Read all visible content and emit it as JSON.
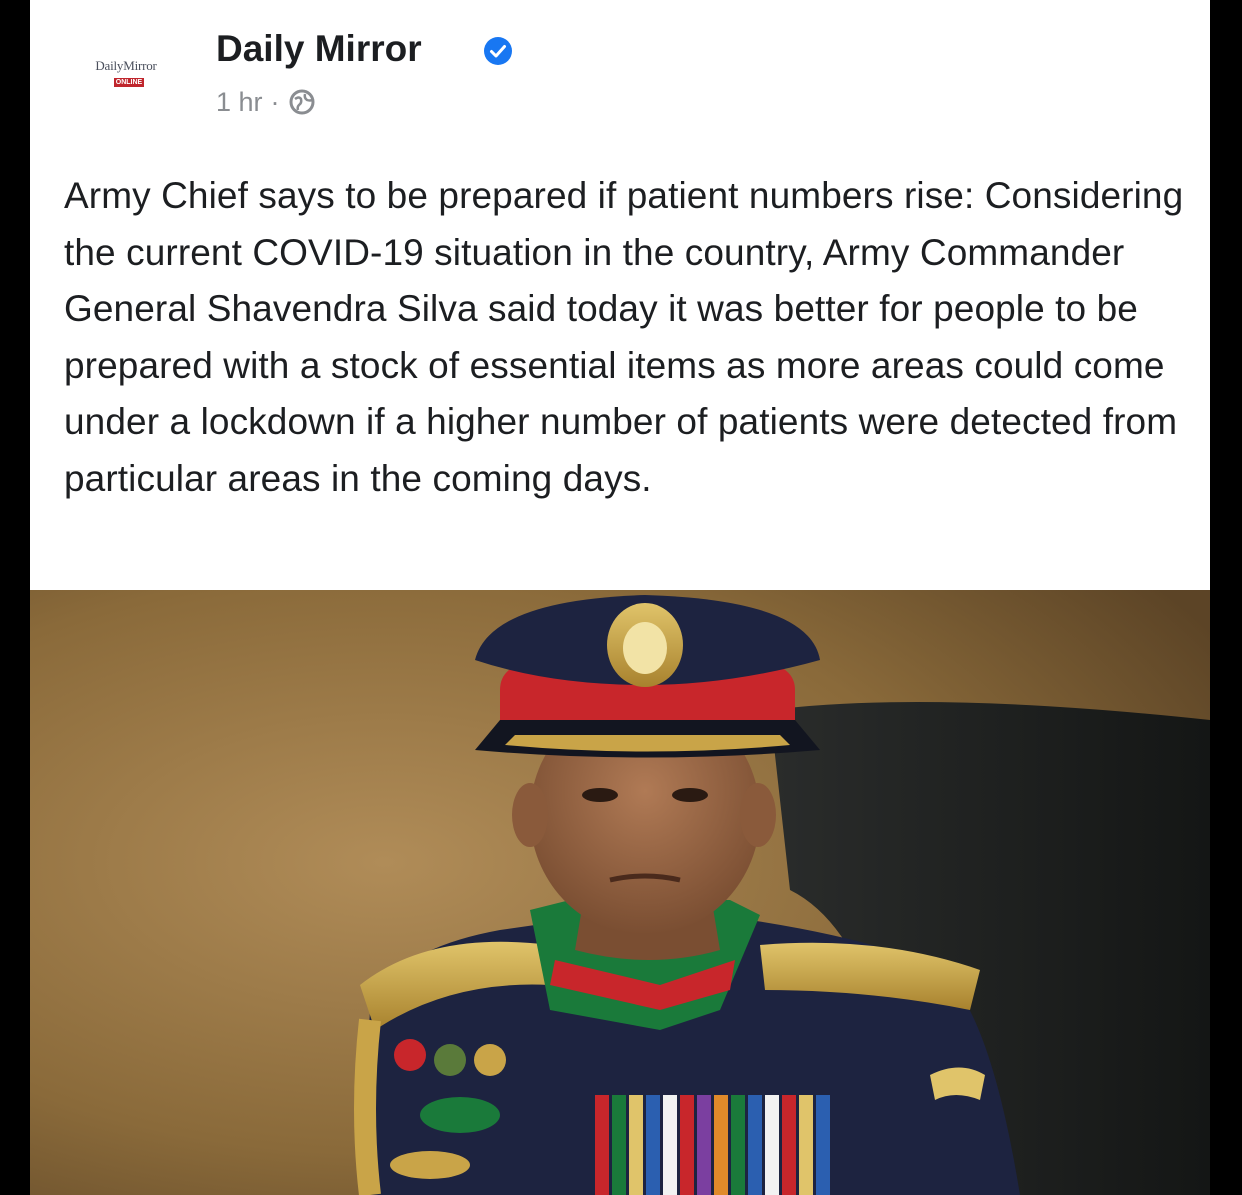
{
  "post": {
    "page_logo_text": "DailyMirror",
    "page_logo_sub": "ONLINE",
    "page_name": "Daily Mirror",
    "verified_icon": "verified-badge-icon",
    "time": "1 hr",
    "separator": "·",
    "audience_icon": "globe-icon",
    "text": "Army Chief says to be prepared if patient numbers rise: Considering the current COVID-19 situation in the country, Army Commander General Shavendra Silva said today it was better for people to be prepared with a stock of essential items as more areas could come under a lockdown if a higher number of patients were detected from particular areas in the coming days."
  },
  "colors": {
    "text": "#1c1e21",
    "meta": "#8a8d91",
    "verified": "#1877f2",
    "background": "#ffffff",
    "frame": "#000000"
  }
}
